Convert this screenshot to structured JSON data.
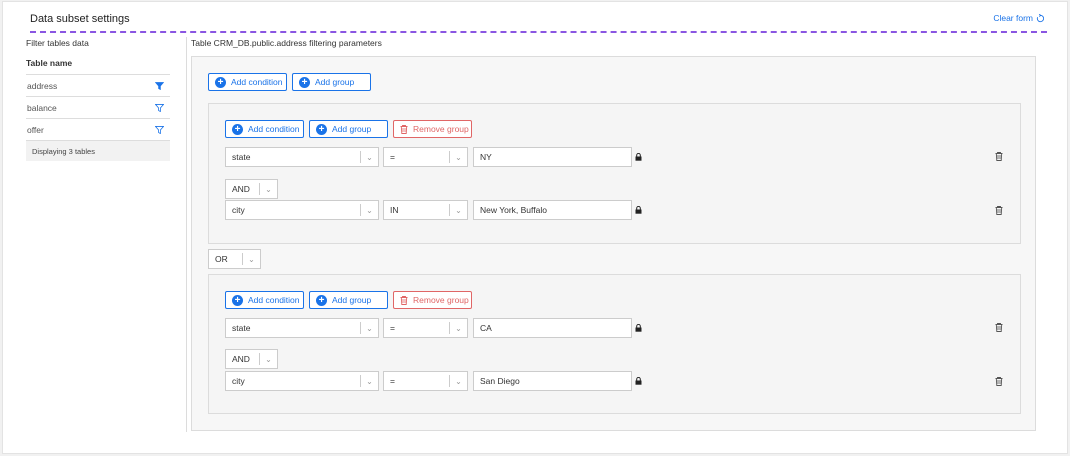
{
  "header": {
    "title": "Data subset settings",
    "clear_label": "Clear form"
  },
  "left": {
    "heading": "Filter tables data",
    "column": "Table name",
    "tables": [
      {
        "name": "address",
        "filter": "filled"
      },
      {
        "name": "balance",
        "filter": "outline"
      },
      {
        "name": "offer",
        "filter": "outline"
      }
    ],
    "count": "Displaying 3 tables"
  },
  "right": {
    "title": "Table CRM_DB.public.address filtering parameters",
    "add_condition": "Add condition",
    "add_group": "Add group",
    "remove_group": "Remove group",
    "between_groups": "OR",
    "groups": [
      {
        "join": "AND",
        "conditions": [
          {
            "field": "state",
            "op": "=",
            "value": "NY"
          },
          {
            "field": "city",
            "op": "IN",
            "value": "New York, Buffalo"
          }
        ]
      },
      {
        "join": "AND",
        "conditions": [
          {
            "field": "state",
            "op": "=",
            "value": "CA"
          },
          {
            "field": "city",
            "op": "=",
            "value": "San Diego"
          }
        ]
      }
    ]
  },
  "colors": {
    "accent": "#1a73e8",
    "danger": "#e06666",
    "dash": "#8a56e2"
  }
}
